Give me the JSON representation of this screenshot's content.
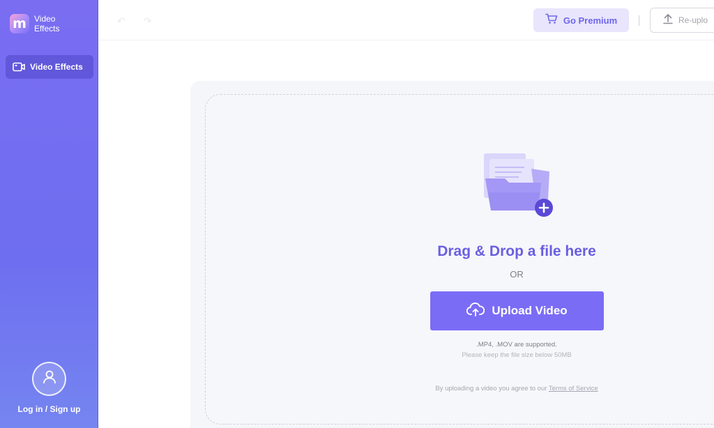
{
  "sidebar": {
    "brand_name": "Video Effects",
    "brand_logo_letter": "m",
    "nav_items": [
      {
        "label": "Video Effects",
        "icon": "video-camera-icon",
        "active": true
      }
    ],
    "login_label": "Log in / Sign up"
  },
  "topbar": {
    "premium_label": "Go Premium",
    "reupload_label": "Re-uplo"
  },
  "uploader": {
    "headline": "Drag & Drop a file here",
    "or_label": "OR",
    "upload_button_label": "Upload Video",
    "supported_formats": ".MP4, .MOV are supported.",
    "size_limit": "Please keep the file size below 50MB",
    "terms_prefix": "By uploading a video you agree to our",
    "terms_link": "Terms of Service"
  },
  "colors": {
    "sidebar": "#7a6df2",
    "accent": "#7b6cf6",
    "headline": "#6a5fe0",
    "premium_bg": "#e8e5fd"
  }
}
